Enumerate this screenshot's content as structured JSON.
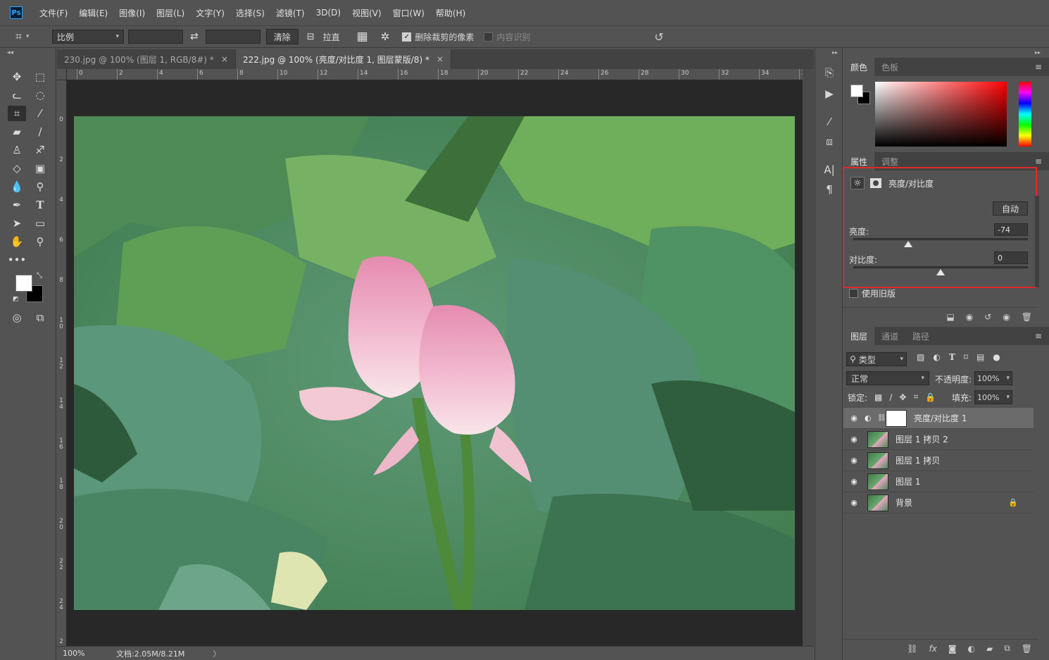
{
  "menubar": {
    "logo": "Ps",
    "items": [
      "文件(F)",
      "编辑(E)",
      "图像(I)",
      "图层(L)",
      "文字(Y)",
      "选择(S)",
      "滤镜(T)",
      "3D(D)",
      "视图(V)",
      "窗口(W)",
      "帮助(H)"
    ]
  },
  "options": {
    "ratio_label": "比例",
    "clear_label": "清除",
    "straighten_label": "拉直",
    "delete_cropped_label": "删除裁剪的像素",
    "delete_cropped_checked": true,
    "content_aware_label": "内容识别",
    "content_aware_checked": false
  },
  "tabs": [
    {
      "label": "230.jpg @ 100% (图层 1, RGB/8#) *",
      "close": "×",
      "active": false
    },
    {
      "label": "222.jpg @ 100% (亮度/对比度 1, 图层蒙版/8) *",
      "close": "×",
      "active": true
    }
  ],
  "ruler": {
    "h_labels": [
      "0",
      "2",
      "4",
      "6",
      "8",
      "10",
      "12",
      "14",
      "16",
      "18",
      "20",
      "22",
      "24",
      "26",
      "28",
      "30",
      "32",
      "34",
      "36"
    ],
    "v_labels": [
      "0",
      "2",
      "4",
      "6",
      "8",
      "10",
      "12",
      "14",
      "16",
      "18",
      "20",
      "22",
      "24",
      "2"
    ]
  },
  "status": {
    "zoom": "100%",
    "doc_info": "文档:2.05M/8.21M",
    "arrow": "〉"
  },
  "color_panel": {
    "tabs": [
      "颜色",
      "色板"
    ],
    "fg_color": "#ffffff",
    "bg_color": "#000000"
  },
  "properties": {
    "tabs": [
      "属性",
      "调整"
    ],
    "adjustment_title": "亮度/对比度",
    "auto_label": "自动",
    "brightness_label": "亮度:",
    "brightness_value": "-74",
    "brightness_fraction": 0.315,
    "contrast_label": "对比度:",
    "contrast_value": "0",
    "contrast_fraction": 0.5,
    "legacy_label": "使用旧版",
    "legacy_checked": false,
    "highlight_color": "#e02a2a"
  },
  "layers_panel": {
    "tabs": [
      "图层",
      "通道",
      "路径"
    ],
    "filter_label": "类型",
    "blend_mode": "正常",
    "opacity_label": "不透明度:",
    "opacity_value": "100%",
    "lock_label": "锁定:",
    "fill_label": "填充:",
    "fill_value": "100%",
    "layers": [
      {
        "name": "亮度/对比度 1",
        "selected": true,
        "type": "adjustment",
        "locked": false
      },
      {
        "name": "图层 1 拷贝 2",
        "selected": false,
        "type": "image",
        "locked": false
      },
      {
        "name": "图层 1 拷贝",
        "selected": false,
        "type": "image",
        "locked": false
      },
      {
        "name": "图层 1",
        "selected": false,
        "type": "image",
        "locked": false
      },
      {
        "name": "背景",
        "selected": false,
        "type": "image",
        "locked": true
      }
    ]
  }
}
